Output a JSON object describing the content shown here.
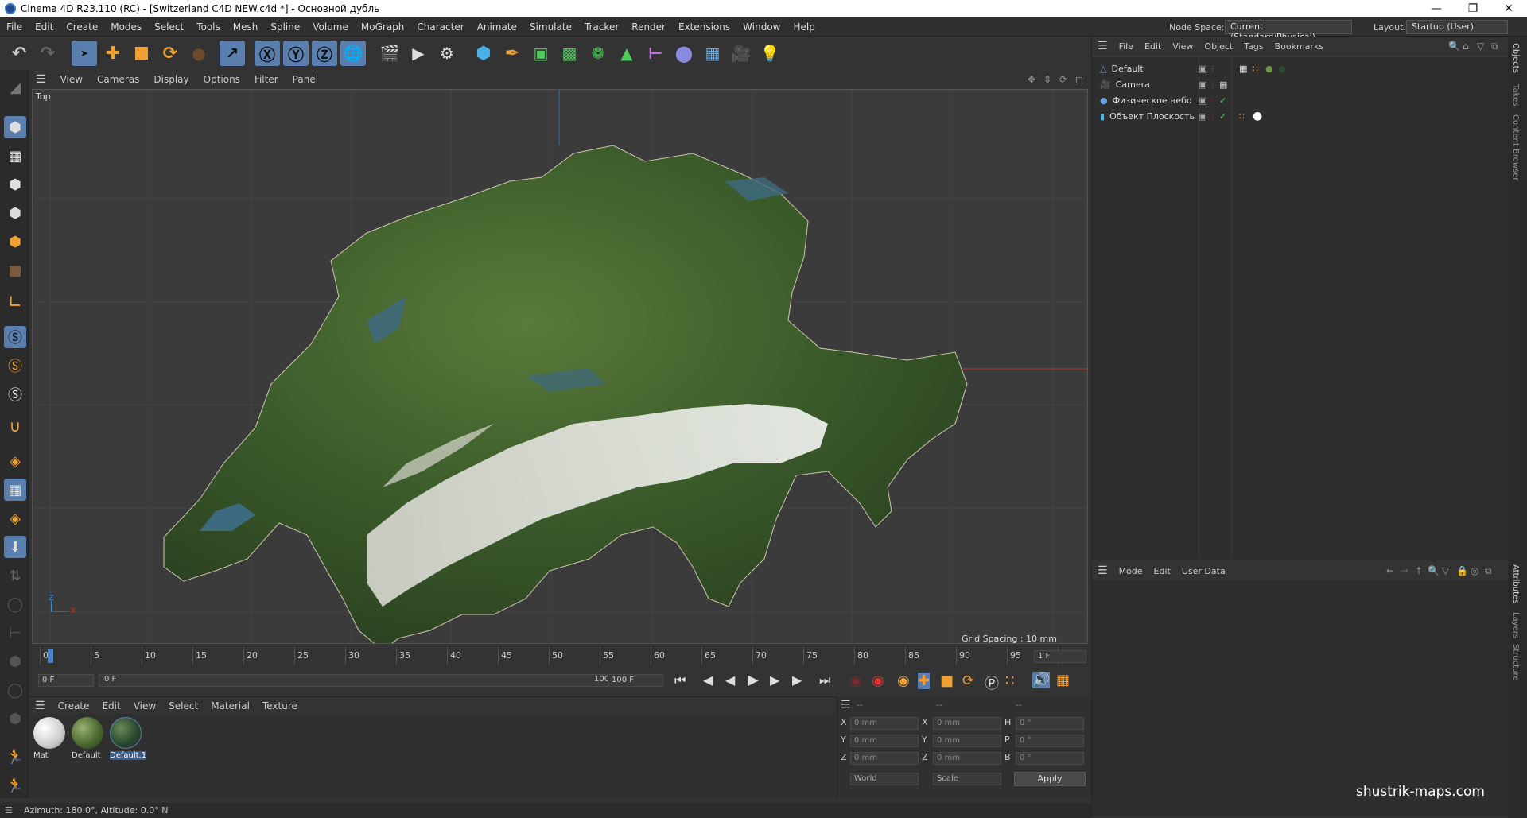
{
  "window": {
    "title": "Cinema 4D R23.110 (RC) - [Switzerland C4D NEW.c4d *] - Основной дубль"
  },
  "menubar": {
    "items": [
      "File",
      "Edit",
      "Create",
      "Modes",
      "Select",
      "Tools",
      "Mesh",
      "Spline",
      "Volume",
      "MoGraph",
      "Character",
      "Animate",
      "Simulate",
      "Tracker",
      "Render",
      "Extensions",
      "Window",
      "Help"
    ]
  },
  "node_space": {
    "label": "Node Space:",
    "value": "Current (Standard/Physical)"
  },
  "layout": {
    "label": "Layout:",
    "value": "Startup (User)"
  },
  "viewport": {
    "menu": [
      "View",
      "Cameras",
      "Display",
      "Options",
      "Filter",
      "Panel"
    ],
    "view_name": "Top",
    "grid_spacing": "Grid Spacing : 10 mm",
    "axis_z": "Z",
    "axis_x": "X"
  },
  "timeline": {
    "ticks": [
      "0",
      "5",
      "10",
      "15",
      "20",
      "25",
      "30",
      "35",
      "40",
      "45",
      "50",
      "55",
      "60",
      "65",
      "70",
      "75",
      "80",
      "85",
      "90",
      "95",
      "10"
    ],
    "current_frame": "1 F",
    "start_field": "0 F",
    "range_start": "0 F",
    "range_end": "100 F",
    "end_field": "100 F"
  },
  "material_manager": {
    "menu": [
      "Create",
      "Edit",
      "View",
      "Select",
      "Material",
      "Texture"
    ],
    "materials": [
      {
        "name": "Mat"
      },
      {
        "name": "Default"
      },
      {
        "name": "Default.1"
      }
    ]
  },
  "coordinates": {
    "header": [
      "--",
      "--",
      "--"
    ],
    "rows": [
      {
        "a": "X",
        "av": "0 mm",
        "b": "X",
        "bv": "0 mm",
        "c": "H",
        "cv": "0 °"
      },
      {
        "a": "Y",
        "av": "0 mm",
        "b": "Y",
        "bv": "0 mm",
        "c": "P",
        "cv": "0 °"
      },
      {
        "a": "Z",
        "av": "0 mm",
        "b": "Z",
        "bv": "0 mm",
        "c": "B",
        "cv": "0 °"
      }
    ],
    "mode1": "World",
    "mode2": "Scale",
    "apply": "Apply"
  },
  "object_manager": {
    "menu": [
      "File",
      "Edit",
      "View",
      "Object",
      "Tags",
      "Bookmarks"
    ],
    "objects": [
      {
        "name": "Default"
      },
      {
        "name": "Camera"
      },
      {
        "name": "Физическое небо"
      },
      {
        "name": "Объект Плоскость"
      }
    ]
  },
  "attribute_manager": {
    "menu": [
      "Mode",
      "Edit",
      "User Data"
    ]
  },
  "right_tabs": {
    "top": [
      "Objects",
      "Takes",
      "Content Browser"
    ],
    "bottom": [
      "Attributes",
      "Layers",
      "Structure"
    ]
  },
  "status": {
    "text": "Azimuth: 180.0°, Altitude: 0.0°  N"
  },
  "watermark": "shustrik-maps.com",
  "colors": {
    "accent": "#5a7fae",
    "orange": "#f0a030",
    "panel": "#333333"
  }
}
